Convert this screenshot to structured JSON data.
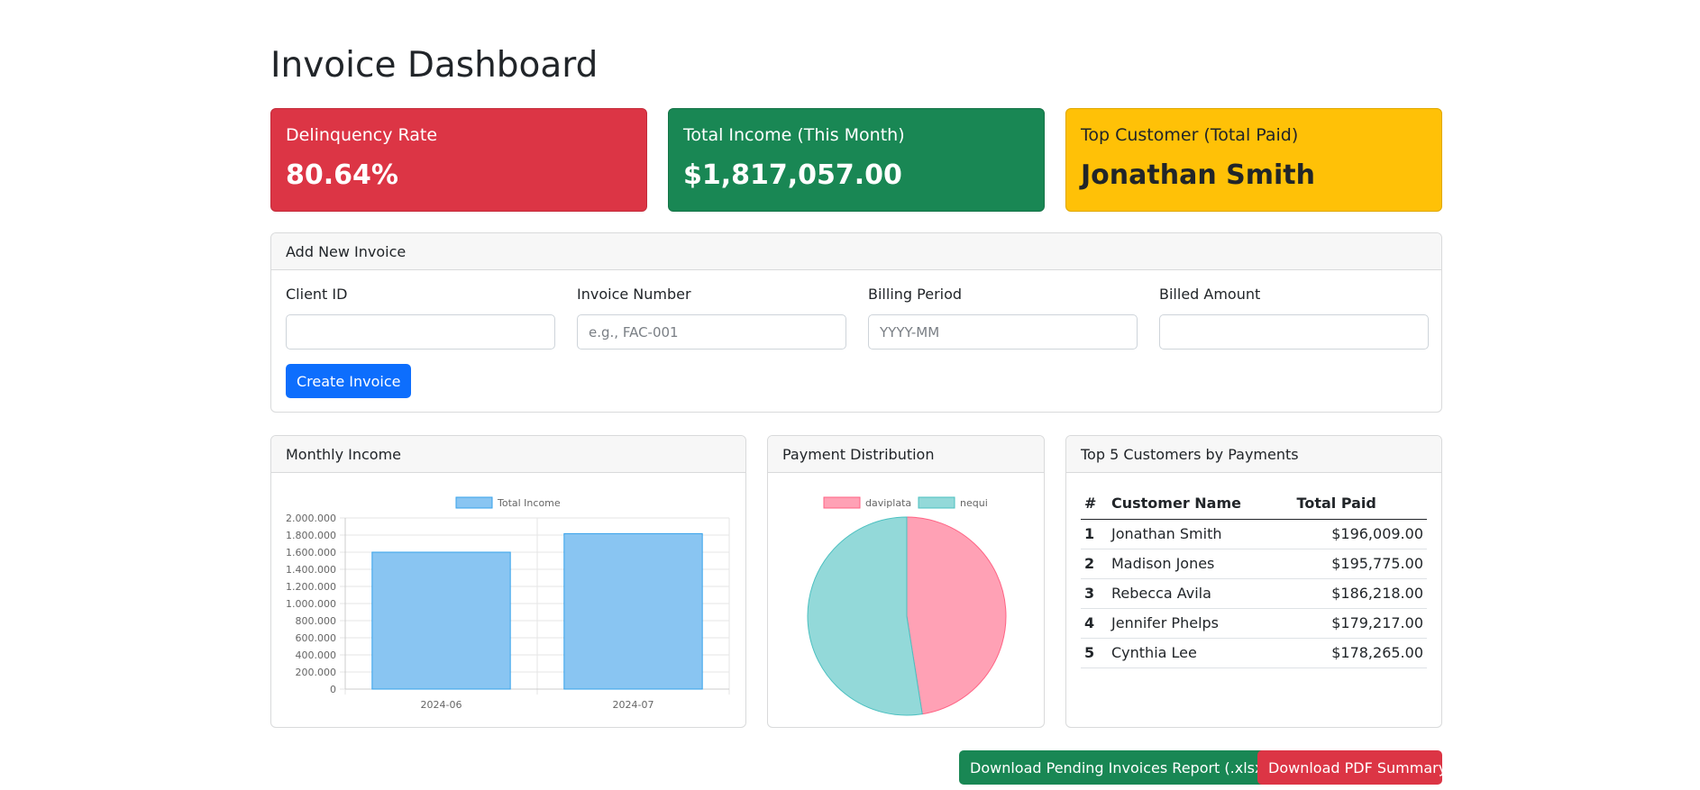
{
  "page": {
    "title": "Invoice Dashboard"
  },
  "stats": {
    "delinquency": {
      "label": "Delinquency Rate",
      "value": "80.64%"
    },
    "income": {
      "label": "Total Income (This Month)",
      "value": "$1,817,057.00"
    },
    "top_customer": {
      "label": "Top Customer (Total Paid)",
      "value": "Jonathan Smith"
    }
  },
  "form": {
    "header": "Add New Invoice",
    "client_id": {
      "label": "Client ID",
      "value": "",
      "placeholder": ""
    },
    "invoice_number": {
      "label": "Invoice Number",
      "value": "",
      "placeholder": "e.g., FAC-001"
    },
    "billing_period": {
      "label": "Billing Period",
      "value": "",
      "placeholder": "YYYY-MM"
    },
    "billed_amount": {
      "label": "Billed Amount",
      "value": "",
      "placeholder": ""
    },
    "submit_label": "Create Invoice"
  },
  "monthly_income": {
    "header": "Monthly Income"
  },
  "payment_distribution": {
    "header": "Payment Distribution"
  },
  "top_customers": {
    "header": "Top 5 Customers by Payments",
    "columns": [
      "#",
      "Customer Name",
      "Total Paid"
    ],
    "rows": [
      {
        "rank": "1",
        "name": "Jonathan Smith",
        "total": "$196,009.00"
      },
      {
        "rank": "2",
        "name": "Madison Jones",
        "total": "$195,775.00"
      },
      {
        "rank": "3",
        "name": "Rebecca Avila",
        "total": "$186,218.00"
      },
      {
        "rank": "4",
        "name": "Jennifer Phelps",
        "total": "$179,217.00"
      },
      {
        "rank": "5",
        "name": "Cynthia Lee",
        "total": "$178,265.00"
      }
    ]
  },
  "actions": {
    "download_xlsx": "Download Pending Invoices Report (.xlsx)",
    "download_pdf": "Download PDF Summary"
  },
  "colors": {
    "danger": "#dc3545",
    "success": "#198754",
    "warning": "#ffc107",
    "primary": "#0d6efd",
    "bar_fill": "#89c5f2",
    "bar_stroke": "#36a2eb",
    "pie_daviplata": "#ffa1b5",
    "pie_nequi": "#93d9d9"
  },
  "chart_data": [
    {
      "type": "bar",
      "categories": [
        "2024-06",
        "2024-07"
      ],
      "series": [
        {
          "name": "Total Income",
          "values": [
            1600000,
            1817057
          ]
        }
      ],
      "ylim": [
        0,
        2000000
      ],
      "yticks": [
        "0",
        "200.000",
        "400.000",
        "600.000",
        "800.000",
        "1.000.000",
        "1.200.000",
        "1.400.000",
        "1.600.000",
        "1.800.000",
        "2.000.000"
      ],
      "legend": "top",
      "grid": true
    },
    {
      "type": "pie",
      "labels": [
        "daviplata",
        "nequi"
      ],
      "values": [
        47.5,
        52.5
      ],
      "legend": "top"
    }
  ]
}
